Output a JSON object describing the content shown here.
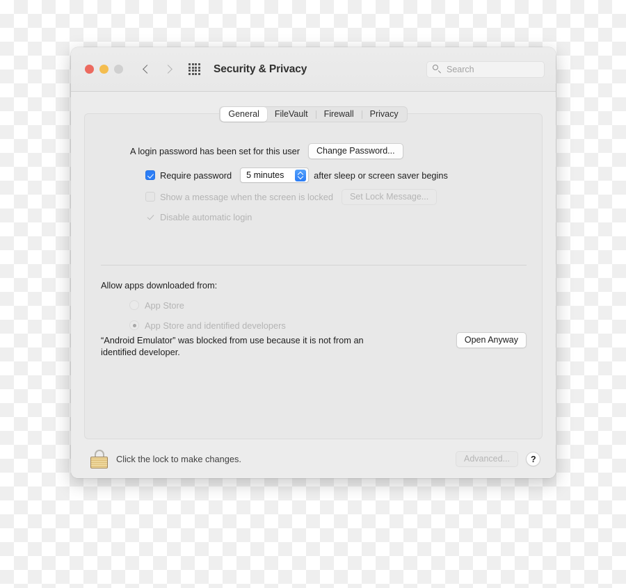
{
  "window": {
    "title": "Security & Privacy",
    "traffic_lights": {
      "close": "close-button",
      "minimize": "minimize-button",
      "zoom": "zoom-button"
    },
    "nav": {
      "back": "back-chevron",
      "forward": "forward-chevron",
      "grid": "show-all-grid"
    },
    "search": {
      "placeholder": "Search",
      "value": ""
    }
  },
  "tabs": [
    {
      "label": "General",
      "active": true
    },
    {
      "label": "FileVault",
      "active": false
    },
    {
      "label": "Firewall",
      "active": false
    },
    {
      "label": "Privacy",
      "active": false
    }
  ],
  "general": {
    "password_status": "A login password has been set for this user",
    "change_password_button": "Change Password...",
    "require_password": {
      "label": "Require password",
      "checked": true,
      "delay_value": "5 minutes",
      "suffix": "after sleep or screen saver begins"
    },
    "lock_message": {
      "label": "Show a message when the screen is locked",
      "checked": false,
      "disabled": true,
      "button": "Set Lock Message..."
    },
    "disable_auto_login": {
      "label": "Disable automatic login",
      "checked": true,
      "disabled": true
    },
    "allow_apps": {
      "title": "Allow apps downloaded from:",
      "options": [
        {
          "label": "App Store",
          "selected": false
        },
        {
          "label": "App Store and identified developers",
          "selected": true
        }
      ],
      "disabled": true
    },
    "blocked_notice": {
      "text": "“Android Emulator” was blocked from use because it is not from an identified developer.",
      "button": "Open Anyway"
    }
  },
  "footer": {
    "lock_icon": "closed-padlock",
    "lock_caption": "Click the lock to make changes.",
    "advanced_button": "Advanced...",
    "help_button": "?"
  },
  "colors": {
    "accent_blue": "#2b7df6",
    "close_red": "#ec6a5f",
    "minimize_yellow": "#f4bd4f",
    "zoom_gray": "#d0d0d0",
    "lock_gold": "#ddbd77",
    "window_bg": "#ececec",
    "panel_bg": "#e8e8e8"
  }
}
